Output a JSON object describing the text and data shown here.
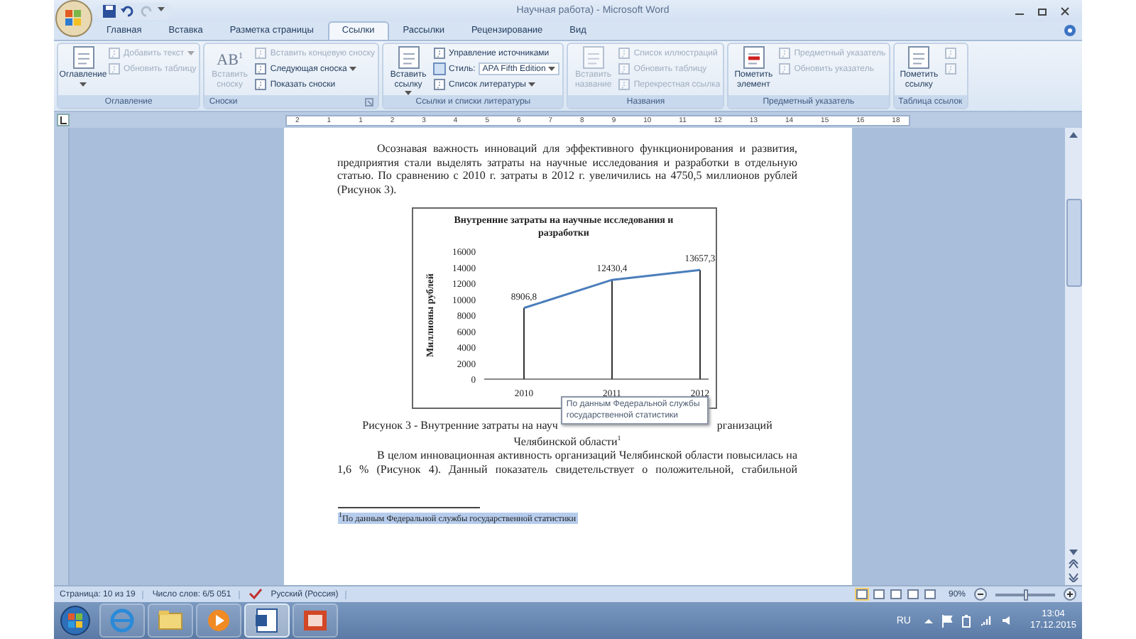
{
  "window": {
    "title": "Научная работа) - Microsoft Word"
  },
  "tabs": [
    {
      "label": "Главная",
      "selected": false
    },
    {
      "label": "Вставка",
      "selected": false
    },
    {
      "label": "Разметка страницы",
      "selected": false
    },
    {
      "label": "Ссылки",
      "selected": true
    },
    {
      "label": "Рассылки",
      "selected": false
    },
    {
      "label": "Рецензирование",
      "selected": false
    },
    {
      "label": "Вид",
      "selected": false
    }
  ],
  "ribbon": {
    "groups": [
      {
        "label": "Оглавление",
        "launcher": false,
        "items": [
          {
            "kind": "large",
            "label": "Оглавление",
            "disabled": false,
            "dropdown": true
          },
          {
            "kind": "small",
            "label": "Добавить текст",
            "disabled": true,
            "dropdown": true
          },
          {
            "kind": "small",
            "label": "Обновить таблицу",
            "disabled": true,
            "dropdown": false
          }
        ]
      },
      {
        "label": "Сноски",
        "launcher": true,
        "items": [
          {
            "kind": "glyph",
            "icon_text": "AB$^{1}$",
            "label": "Вставить сноску",
            "disabled": true,
            "dropdown": false
          },
          {
            "kind": "small",
            "label": "Вставить концевую сноску",
            "disabled": true,
            "dropdown": false
          },
          {
            "kind": "small",
            "label": "Следующая сноска",
            "disabled": false,
            "dropdown": true
          },
          {
            "kind": "small",
            "label": "Показать сноски",
            "disabled": false,
            "dropdown": false
          }
        ]
      },
      {
        "label": "Ссылки и списки литературы",
        "launcher": false,
        "items": [
          {
            "kind": "large",
            "label": "Вставить ссылку",
            "disabled": false,
            "dropdown": true
          },
          {
            "kind": "small",
            "label": "Управление источниками",
            "disabled": false,
            "dropdown": false
          },
          {
            "kind": "style",
            "label": "Стиль:",
            "value": "APA Fifth Edition",
            "disabled": false,
            "dropdown": true
          },
          {
            "kind": "small",
            "label": "Список литературы",
            "disabled": false,
            "dropdown": true
          }
        ]
      },
      {
        "label": "Названия",
        "launcher": false,
        "items": [
          {
            "kind": "large",
            "label": "Вставить название",
            "disabled": true,
            "dropdown": false
          },
          {
            "kind": "small",
            "label": "Список иллюстраций",
            "disabled": true,
            "dropdown": false
          },
          {
            "kind": "small",
            "label": "Обновить таблицу",
            "disabled": true,
            "dropdown": false
          },
          {
            "kind": "small",
            "label": "Перекрестная ссылка",
            "disabled": true,
            "dropdown": false
          }
        ]
      },
      {
        "label": "Предметный указатель",
        "launcher": false,
        "items": [
          {
            "kind": "large",
            "label": "Пометить элемент",
            "disabled": false,
            "dropdown": false
          },
          {
            "kind": "small",
            "label": "Предметный указатель",
            "disabled": true,
            "dropdown": false
          },
          {
            "kind": "small",
            "label": "Обновить указатель",
            "disabled": true,
            "dropdown": false
          }
        ]
      },
      {
        "label": "Таблица ссылок",
        "launcher": false,
        "items": [
          {
            "kind": "large",
            "label": "Пометить ссылку",
            "disabled": false,
            "dropdown": false
          },
          {
            "kind": "icon",
            "disabled": true,
            "dropdown": false
          },
          {
            "kind": "icon",
            "disabled": true,
            "dropdown": false
          }
        ]
      }
    ]
  },
  "ruler": {
    "labels": [
      "2",
      "1",
      "1",
      "2",
      "3",
      "4",
      "5",
      "6",
      "7",
      "8",
      "9",
      "10",
      "11",
      "12",
      "13",
      "14",
      "15",
      "16",
      "18"
    ]
  },
  "document": {
    "paragraph_1": "Осознавая важность инноваций для эффективного функционирования и развития, предприятия стали выделять затраты на научные исследования и разработки в отдельную статью. По сравнению с 2010 г. затраты в 2012 г. увеличились на 4750,5 миллионов рублей (Рисунок 3).",
    "chart": {
      "chart_data": {
        "type": "line",
        "title": "Внутренние затраты на научные исследования и разработки",
        "ylabel": "Миллионы рублей",
        "categories": [
          "2010",
          "2011",
          "2012"
        ],
        "series": [
          {
            "color": "#4a7ebb",
            "values": [
              8906.8,
              12430.4,
              13657.3
            ]
          }
        ],
        "ylim": [
          0,
          16000
        ],
        "yticks": [
          0,
          2000,
          4000,
          6000,
          8000,
          10000,
          12000,
          14000,
          16000
        ],
        "value_labels": [
          "8906,8",
          "12430,4",
          "13657,3"
        ]
      }
    },
    "caption_visible_start": "Рисунок 3 - Внутренние затраты на науч",
    "caption_visible_end": "рганизаций",
    "caption_line_2": "Челябинской области$^{1}$",
    "tooltip": "По данным Федеральной службы государственной статистики",
    "paragraph_2": "В целом инновационная активность организаций Челябинской области повысилась на 1,6 % (Рисунок 4). Данный показатель свидетельствует о положительной, стабильной",
    "footnote": {
      "text": "$^{1}$По данным Федеральной службы государственной статистики",
      "selected": true
    }
  },
  "status_bar": {
    "page": "Страница: 10 из 19",
    "words": "Число слов: 6/5 051",
    "language": "Русский (Россия)",
    "views": [
      {
        "selected": true
      },
      {
        "selected": false
      },
      {
        "selected": false
      },
      {
        "selected": false
      },
      {
        "selected": false
      }
    ],
    "zoom": "90%",
    "zoom_slider": {
      "level": 0.5
    }
  },
  "taskbar": {
    "apps": [
      {
        "kind": "browser",
        "selected": false
      },
      {
        "kind": "folder",
        "selected": false
      },
      {
        "kind": "player",
        "selected": false
      },
      {
        "kind": "word",
        "selected": true
      },
      {
        "kind": "slides",
        "selected": false
      }
    ],
    "language": "RU",
    "time": "13:04",
    "date": "17.12.2015"
  }
}
